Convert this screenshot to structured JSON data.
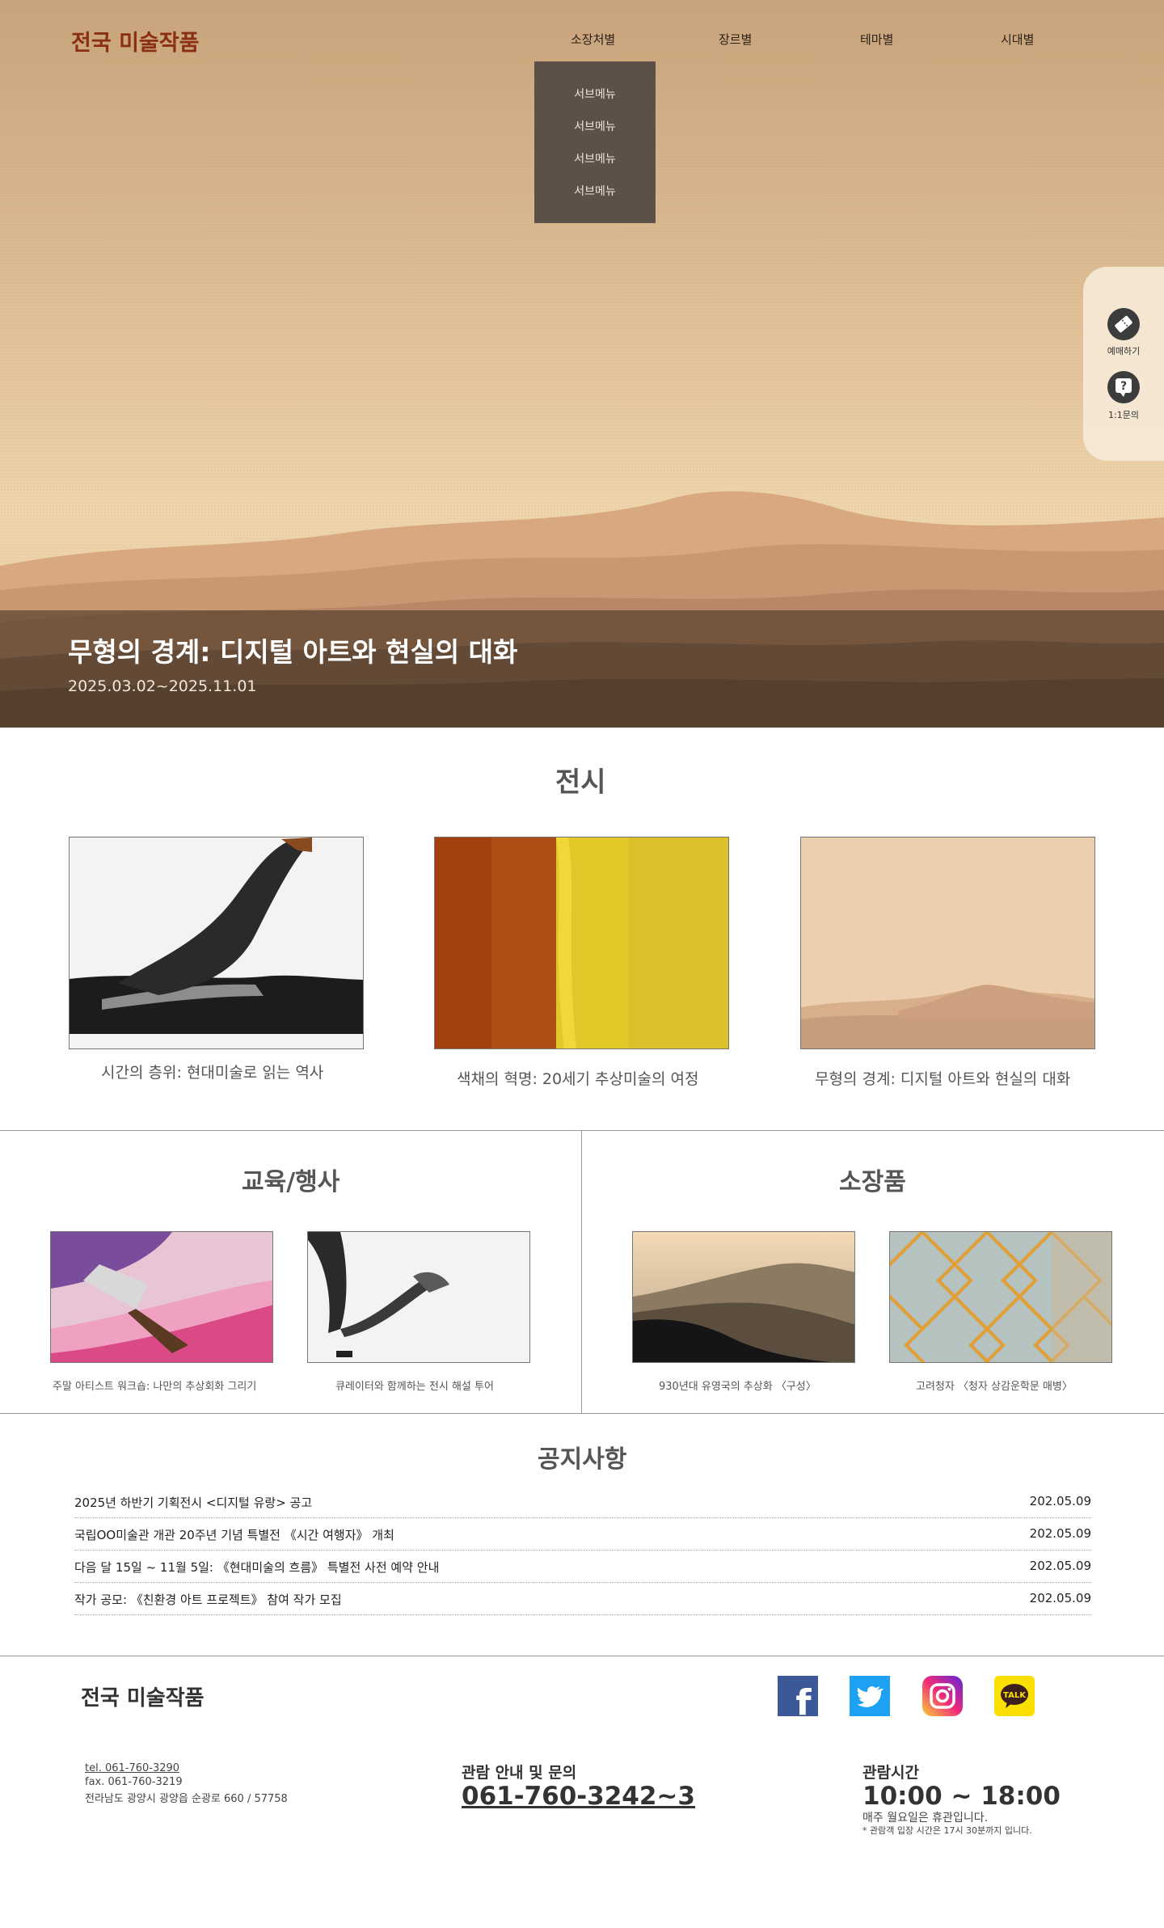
{
  "header": {
    "logo": "전국 미술작품",
    "nav": [
      "소장처별",
      "장르별",
      "테마별",
      "시대별"
    ],
    "submenu": [
      "서브메뉴",
      "서브메뉴",
      "서브메뉴",
      "서브메뉴"
    ]
  },
  "quick": {
    "reserve_label": "예매하기",
    "inquiry_label": "1:1문의",
    "inquiry_glyph": "?"
  },
  "hero": {
    "title": "무형의 경계: 디지털 아트와 현실의 대화",
    "date": "2025.03.02~2025.11.01"
  },
  "exhibition": {
    "title": "전시",
    "items": [
      {
        "caption": "시간의 층위: 현대미술로 읽는 역사"
      },
      {
        "caption": "색채의 혁명: 20세기 추상미술의 여정"
      },
      {
        "caption": "무형의 경계: 디지털 아트와 현실의 대화"
      }
    ]
  },
  "education": {
    "title": "교육/행사",
    "items": [
      {
        "caption": "주말 아티스트 워크숍: 나만의 추상회화 그리기"
      },
      {
        "caption": "큐레이터와 함께하는 전시 해설 투어"
      }
    ]
  },
  "collection": {
    "title": "소장품",
    "items": [
      {
        "caption": "930년대 유영국의 추상화 〈구성〉"
      },
      {
        "caption": "고려청자 〈청자 상감운학문 매병〉"
      }
    ]
  },
  "notice": {
    "title": "공지사항",
    "items": [
      {
        "title": "2025년 하반기 기획전시 <디지털 유랑> 공고",
        "date": "202.05.09"
      },
      {
        "title": "국립OO미술관 개관 20주년 기념 특별전 《시간 여행자》 개최",
        "date": "202.05.09"
      },
      {
        "title": "다음 달 15일 ~ 11월 5일: 《현대미술의 흐름》 특별전 사전 예약 안내",
        "date": "202.05.09"
      },
      {
        "title": "작가 공모: 《친환경 아트 프로젝트》 참여 작가 모집",
        "date": "202.05.09"
      }
    ]
  },
  "footer": {
    "logo": "전국 미술작품",
    "social": {
      "facebook": "f",
      "kakao": "TALK"
    },
    "tel": "tel. 061-760-3290",
    "fax": "fax. 061-760-3219",
    "address": "전라남도 광양시 광양읍 순광로 660 / 57758",
    "inquiry_title": "관람 안내 및 문의",
    "inquiry_phone": "061-760-3242~3",
    "hours_title": "관람시간",
    "hours": "10:00 ~ 18:00",
    "closed": "매주 월요일은 휴관입니다.",
    "last_entry": "* 관람객 입장 시간은 17시 30분까지 입니다."
  },
  "colors": {
    "logo": "#8a2f14",
    "submenu_bg": "#5b5147",
    "facebook": "#3b5998",
    "twitter": "#1da1f2",
    "kakao": "#f9e000"
  }
}
